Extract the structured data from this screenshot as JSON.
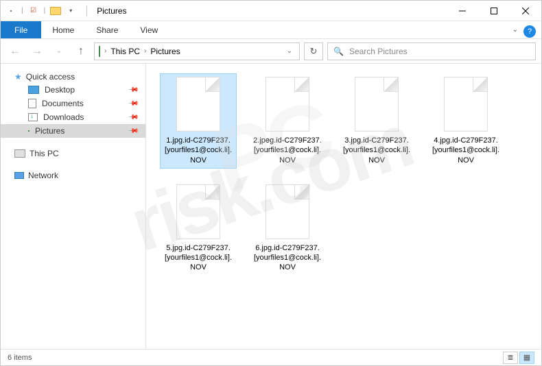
{
  "window": {
    "title": "Pictures"
  },
  "ribbon": {
    "file": "File",
    "tabs": [
      "Home",
      "Share",
      "View"
    ]
  },
  "breadcrumb": {
    "items": [
      "This PC",
      "Pictures"
    ]
  },
  "search": {
    "placeholder": "Search Pictures",
    "icon": "search-icon"
  },
  "sidebar": {
    "quick_access": {
      "label": "Quick access",
      "items": [
        {
          "label": "Desktop",
          "icon": "desktop-icon",
          "pinned": true
        },
        {
          "label": "Documents",
          "icon": "documents-icon",
          "pinned": true
        },
        {
          "label": "Downloads",
          "icon": "downloads-icon",
          "pinned": true
        },
        {
          "label": "Pictures",
          "icon": "pictures-icon",
          "pinned": true,
          "selected": true
        }
      ]
    },
    "this_pc": {
      "label": "This PC"
    },
    "network": {
      "label": "Network"
    }
  },
  "files": [
    {
      "name": "1.jpg.id-C279F237.[yourfiles1@cock.li].NOV",
      "selected": true
    },
    {
      "name": "2.jpeg.id-C279F237.[yourfiles1@cock.li].NOV"
    },
    {
      "name": "3.jpg.id-C279F237.[yourfiles1@cock.li].NOV"
    },
    {
      "name": "4.jpg.id-C279F237.[yourfiles1@cock.li].NOV"
    },
    {
      "name": "5.jpg.id-C279F237.[yourfiles1@cock.li].NOV"
    },
    {
      "name": "6.jpg.id-C279F237.[yourfiles1@cock.li].NOV"
    }
  ],
  "status": {
    "count": "6 items"
  },
  "watermark": {
    "text1": "PC",
    "text2": "risk.com"
  }
}
